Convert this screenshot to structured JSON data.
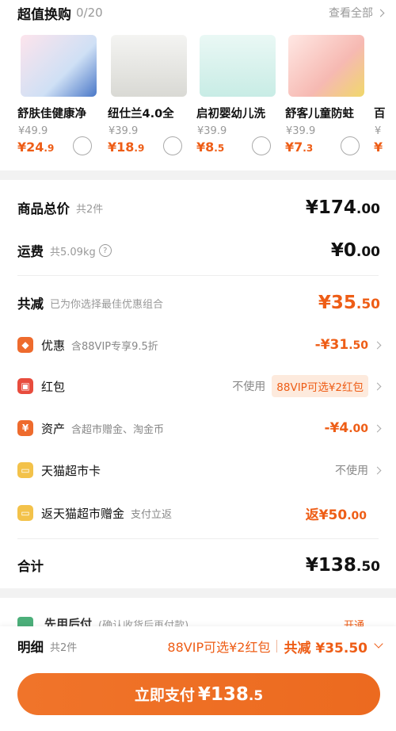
{
  "swap": {
    "title": "超值换购",
    "count": "0/20",
    "view_all": "查看全部",
    "products": [
      {
        "name": "舒肤佳健康净",
        "orig": "¥49.9",
        "price_int": "¥24",
        "price_dec": ".9",
        "img_color": "#cfe0f5"
      },
      {
        "name": "纽仕兰4.0全",
        "orig": "¥39.9",
        "price_int": "¥18",
        "price_dec": ".9",
        "img_color": "#e7e7e3"
      },
      {
        "name": "启初婴幼儿洗",
        "orig": "¥39.9",
        "price_int": "¥8",
        "price_dec": ".5",
        "img_color": "#d8f0ec"
      },
      {
        "name": "舒客儿童防蛀",
        "orig": "¥39.9",
        "price_int": "¥7",
        "price_dec": ".3",
        "img_color": "#f8d9d6"
      },
      {
        "name": "百",
        "orig": "¥",
        "price_int": "¥",
        "price_dec": "",
        "img_color": "#eee"
      }
    ]
  },
  "summary": {
    "total_label": "商品总价",
    "total_sub": "共2件",
    "total_int": "¥174",
    "total_dec": ".00",
    "ship_label": "运费",
    "ship_sub": "共5.09kg",
    "ship_q": "?",
    "ship_int": "¥0",
    "ship_dec": ".00",
    "reduce_label": "共减",
    "reduce_sub": "已为你选择最佳优惠组合",
    "reduce_int": "¥35",
    "reduce_dec": ".50",
    "discount": {
      "icon": "◆",
      "label": "优惠",
      "sub": "含88VIP专享9.5折",
      "amt_int": "-¥31",
      "amt_dec": ".50",
      "color": "#ee6b2d"
    },
    "redpacket": {
      "icon": "▣",
      "label": "红包",
      "not_use": "不使用",
      "vip_tag": "88VIP可选¥2红包",
      "color": "#e84c3d"
    },
    "assets": {
      "icon": "¥",
      "label": "资产",
      "sub": "含超市赠金、淘金币",
      "amt_int": "-¥4",
      "amt_dec": ".00",
      "color": "#ee6b2d"
    },
    "tmall_card": {
      "icon": "▭",
      "label": "天猫超市卡",
      "not_use": "不使用",
      "color": "#f3c24a"
    },
    "cashback": {
      "icon": "▭",
      "label": "返天猫超市赠金",
      "sub": "支付立返",
      "amt_int": "返¥50",
      "amt_dec": ".00",
      "color": "#f3c24a"
    },
    "sum_label": "合计",
    "sum_int": "¥138",
    "sum_dec": ".50"
  },
  "partial": {
    "label": "先用后付",
    "sub": "(确认收货后再付款)",
    "right": "开通"
  },
  "bottom": {
    "label": "明细",
    "count": "共2件",
    "vip": "88VIP可选¥2红包",
    "save": "共减 ¥35.50",
    "pay_text": "立即支付",
    "pay_int": "¥138",
    "pay_dec": ".5"
  }
}
